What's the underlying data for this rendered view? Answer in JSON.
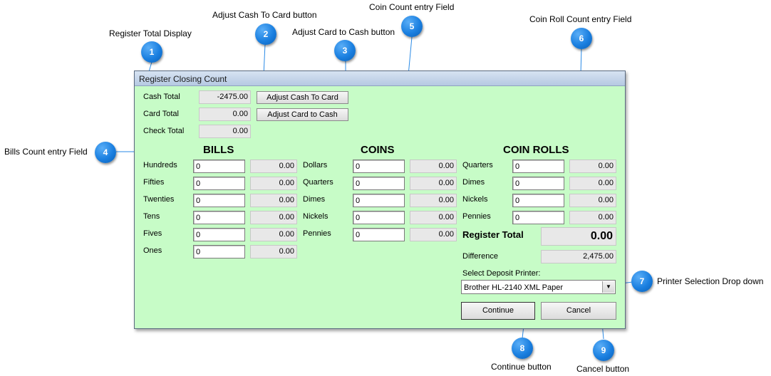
{
  "annotations": {
    "register_total_display": "Register Total Display",
    "adjust_cash_to_card_button": "Adjust Cash To Card button",
    "adjust_card_to_cash_button": "Adjust Card to Cash button",
    "coin_count_entry_field": "Coin Count entry Field",
    "coin_roll_count_entry_field": "Coin Roll Count entry Field",
    "bills_count_entry_field": "Bills Count entry Field",
    "printer_selection_drop_down": "Printer Selection Drop down",
    "continue_button": "Continue button",
    "cancel_button": "Cancel button"
  },
  "badges": [
    "1",
    "2",
    "3",
    "4",
    "5",
    "6",
    "7",
    "8",
    "9"
  ],
  "window": {
    "title": "Register Closing Count"
  },
  "totals": {
    "cash_label": "Cash Total",
    "cash_value": "-2475.00",
    "card_label": "Card Total",
    "card_value": "0.00",
    "check_label": "Check Total",
    "check_value": "0.00"
  },
  "adjust": {
    "cash_to_card": "Adjust Cash To Card",
    "card_to_cash": "Adjust Card to Cash"
  },
  "bills": {
    "heading": "BILLS",
    "rows": [
      {
        "label": "Hundreds",
        "input": "0",
        "value": "0.00"
      },
      {
        "label": "Fifties",
        "input": "0",
        "value": "0.00"
      },
      {
        "label": "Twenties",
        "input": "0",
        "value": "0.00"
      },
      {
        "label": "Tens",
        "input": "0",
        "value": "0.00"
      },
      {
        "label": "Fives",
        "input": "0",
        "value": "0.00"
      },
      {
        "label": "Ones",
        "input": "0",
        "value": "0.00"
      }
    ]
  },
  "coins": {
    "heading": "COINS",
    "rows": [
      {
        "label": "Dollars",
        "input": "0",
        "value": "0.00"
      },
      {
        "label": "Quarters",
        "input": "0",
        "value": "0.00"
      },
      {
        "label": "Dimes",
        "input": "0",
        "value": "0.00"
      },
      {
        "label": "Nickels",
        "input": "0",
        "value": "0.00"
      },
      {
        "label": "Pennies",
        "input": "0",
        "value": "0.00"
      }
    ]
  },
  "coin_rolls": {
    "heading": "COIN ROLLS",
    "rows": [
      {
        "label": "Quarters",
        "input": "0",
        "value": "0.00"
      },
      {
        "label": "Dimes",
        "input": "0",
        "value": "0.00"
      },
      {
        "label": "Nickels",
        "input": "0",
        "value": "0.00"
      },
      {
        "label": "Pennies",
        "input": "0",
        "value": "0.00"
      }
    ]
  },
  "register_total": {
    "label": "Register Total",
    "value": "0.00"
  },
  "difference": {
    "label": "Difference",
    "value": "2,475.00"
  },
  "printer": {
    "label": "Select Deposit Printer:",
    "selected": "Brother HL-2140 XML Paper"
  },
  "buttons": {
    "continue": "Continue",
    "cancel": "Cancel"
  },
  "colors": {
    "panel_bg": "#c7fcc7",
    "badge": "#1a7fe0",
    "callout_line": "#2a8ae6"
  }
}
